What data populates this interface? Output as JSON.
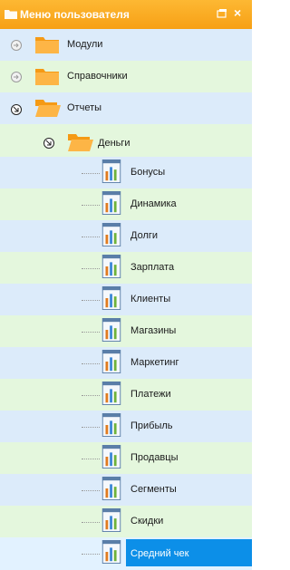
{
  "window": {
    "title": "Меню пользователя"
  },
  "tree": {
    "modules": "Модули",
    "references": "Справочники",
    "reports": "Отчеты",
    "money": "Деньги",
    "items": [
      "Бонусы",
      "Динамика",
      "Долги",
      "Зарплата",
      "Клиенты",
      "Магазины",
      "Маркетинг",
      "Платежи",
      "Прибыль",
      "Продавцы",
      "Сегменты",
      "Скидки",
      "Средний чек"
    ],
    "selected": "Средний чек"
  },
  "colors": {
    "header": "#f7a015",
    "row_blue": "#dcebfa",
    "row_green": "#e4f7dd",
    "selection": "#0c8fe8"
  }
}
